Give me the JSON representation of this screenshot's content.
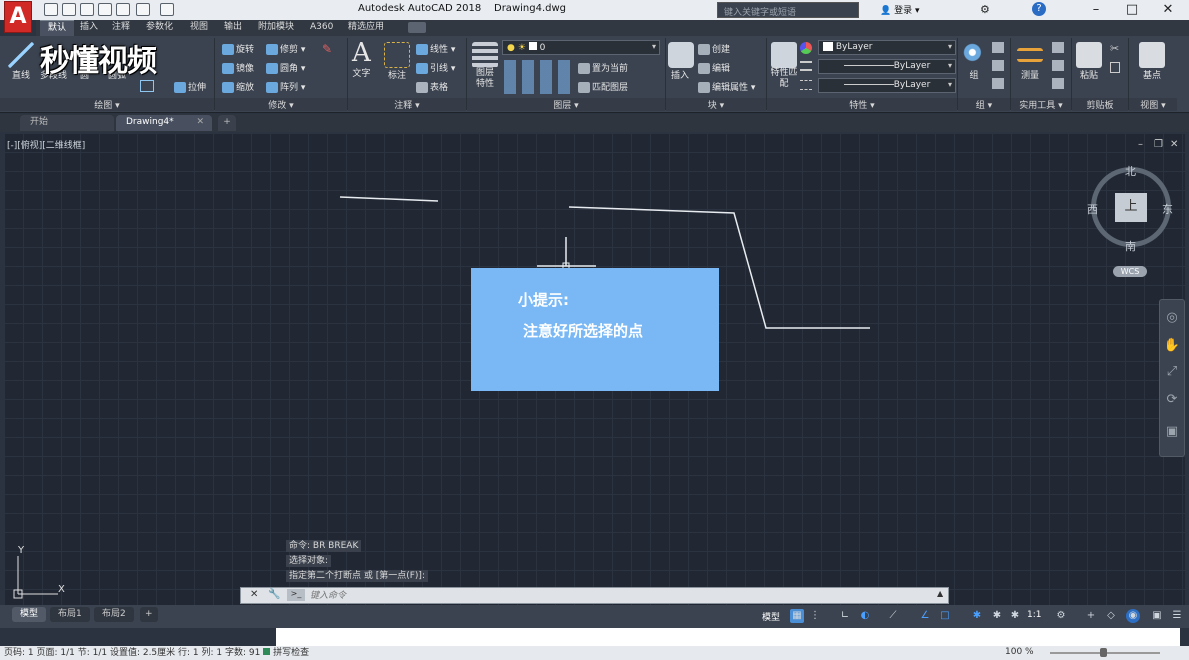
{
  "app": {
    "logo": "A",
    "title": "Autodesk AutoCAD 2018",
    "drawing": "Drawing4.dwg",
    "search_placeholder": "键入关键字或短语",
    "login": "登录"
  },
  "ribbon_tabs": [
    "默认",
    "插入",
    "注释",
    "参数化",
    "视图",
    "输出",
    "附加模块",
    "A360",
    "精选应用"
  ],
  "panels": {
    "draw": {
      "label": "绘图",
      "tools": [
        "直线",
        "多段线",
        "圆",
        "圆弧"
      ]
    },
    "modify": {
      "label": "修改",
      "tools": [
        "旋转",
        "修剪",
        "镜像",
        "圆角",
        "拉伸",
        "缩放",
        "阵列"
      ]
    },
    "annotation": {
      "label": "注释",
      "tools": [
        "文字",
        "标注",
        "线性",
        "引线",
        "表格"
      ]
    },
    "layers": {
      "label": "图层",
      "current_layer": "0",
      "tools": [
        "图层特性",
        "置为当前",
        "匹配图层"
      ]
    },
    "block": {
      "label": "块",
      "tools": [
        "插入",
        "创建",
        "编辑",
        "编辑属性"
      ]
    },
    "properties": {
      "label": "特性",
      "color": "ByLayer",
      "linetype": "ByLayer",
      "lineweight": "ByLayer",
      "tools": [
        "特性匹配"
      ]
    },
    "groups": {
      "label": "组",
      "tools": [
        "组"
      ]
    },
    "utilities": {
      "label": "实用工具",
      "tools": [
        "测量"
      ]
    },
    "clipboard": {
      "label": "剪贴板",
      "tools": [
        "粘贴"
      ]
    },
    "view": {
      "label": "视图",
      "tools": [
        "基点"
      ]
    }
  },
  "file_tabs": [
    "开始",
    "Drawing4*"
  ],
  "viewport_label": "[-][俯视][二维线框]",
  "tip": {
    "title": "小提示:",
    "body": "注意好所选择的点"
  },
  "compass": {
    "north": "北",
    "south": "南",
    "west": "西",
    "east": "东",
    "top": "上",
    "wcs": "WCS"
  },
  "command_history": [
    "命令: BR BREAK",
    "选择对象:",
    "指定第二个打断点 或 [第一点(F)]:"
  ],
  "command_placeholder": "键入命令",
  "layout_tabs": [
    "模型",
    "布局1",
    "布局2"
  ],
  "status": {
    "model": "模型",
    "scale": "1:1"
  },
  "doc_status": "页码: 1  页面: 1/1  节: 1/1  设置值: 2.5厘米  行: 1  列: 1  字数: 91",
  "doc_status_check": "拼写检查",
  "zoom": "100 %",
  "watermark": "秒懂视频",
  "colors": {
    "tip_bg": "#79b8f4",
    "canvas": "#212834",
    "ribbon": "#3b4350"
  }
}
